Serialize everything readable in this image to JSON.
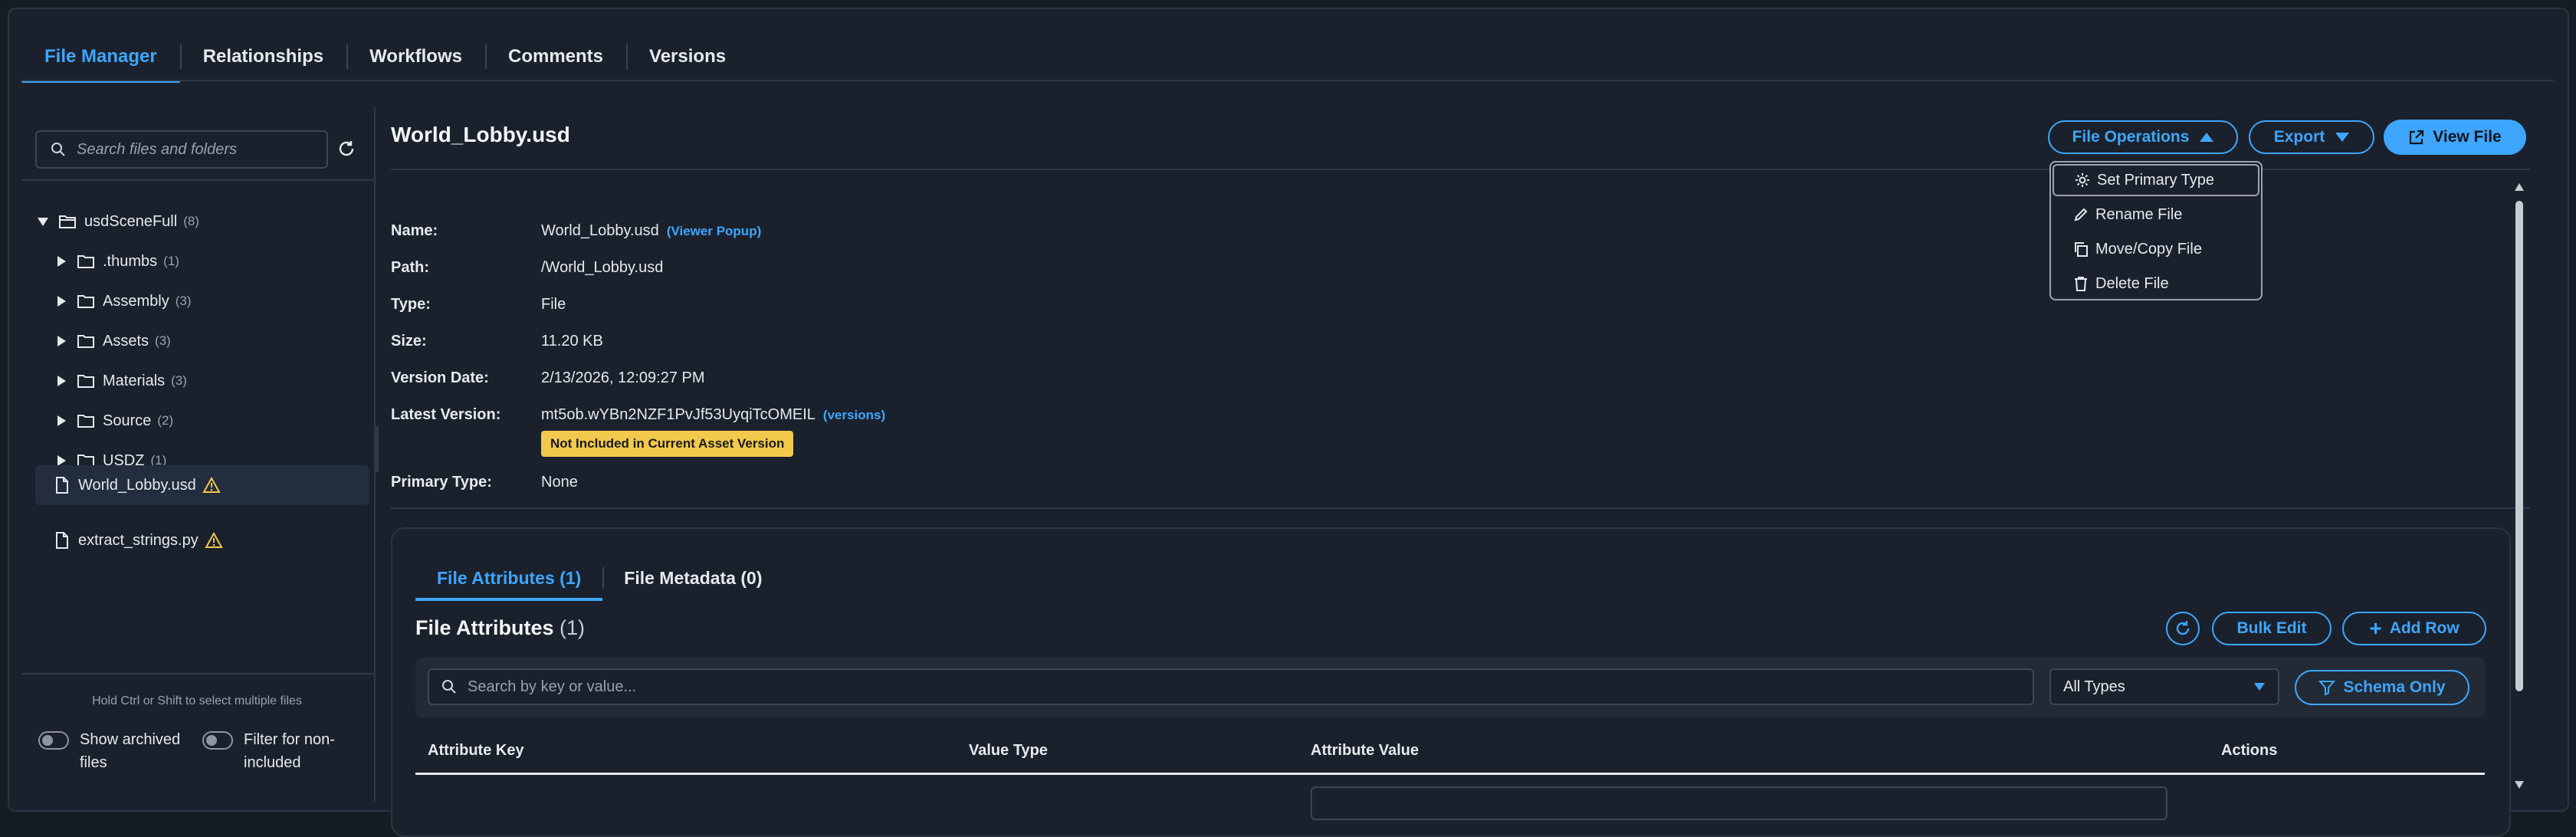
{
  "top_tabs": [
    "File Manager",
    "Relationships",
    "Workflows",
    "Comments",
    "Versions"
  ],
  "sidebar": {
    "search_placeholder": "Search files and folders",
    "root": {
      "name": "usdSceneFull",
      "count": "(8)"
    },
    "folders": [
      {
        "name": ".thumbs",
        "count": "(1)"
      },
      {
        "name": "Assembly",
        "count": "(3)"
      },
      {
        "name": "Assets",
        "count": "(3)"
      },
      {
        "name": "Materials",
        "count": "(3)"
      },
      {
        "name": "Source",
        "count": "(2)"
      },
      {
        "name": "USDZ",
        "count": "(1)"
      }
    ],
    "files": [
      {
        "name": "World_Lobby.usd",
        "warning": true,
        "selected": true
      },
      {
        "name": "extract_strings.py",
        "warning": true,
        "selected": false
      }
    ],
    "hint": "Hold Ctrl or Shift to select multiple files",
    "toggle_archived": [
      "Show archived",
      "files"
    ],
    "toggle_filter": [
      "Filter for non-",
      "included"
    ]
  },
  "main": {
    "title": "World_Lobby.usd",
    "buttons": {
      "file_operations": "File Operations",
      "export": "Export",
      "view_file": "View File"
    },
    "menu": [
      "Set Primary Type",
      "Rename File",
      "Move/Copy File",
      "Delete File"
    ],
    "props": {
      "name_label": "Name:",
      "name_value": "World_Lobby.usd",
      "viewer_link": "(Viewer Popup)",
      "path_label": "Path:",
      "path_value": "/World_Lobby.usd",
      "type_label": "Type:",
      "type_value": "File",
      "size_label": "Size:",
      "size_value": "11.20 KB",
      "version_date_label": "Version Date:",
      "version_date_value": "2/13/2026, 12:09:27 PM",
      "latest_version_label": "Latest Version:",
      "latest_version_value": "mt5ob.wYBn2NZF1PvJf53UyqiTcOMEIL",
      "versions_link": "(versions)",
      "badge": "Not Included in Current Asset Version",
      "primary_type_label": "Primary Type:",
      "primary_type_value": "None"
    }
  },
  "attributes": {
    "tabs": [
      "File Attributes (1)",
      "File Metadata (0)"
    ],
    "title": "File Attributes",
    "count": "(1)",
    "bulk_edit": "Bulk Edit",
    "add_row": "Add Row",
    "search_placeholder": "Search by key or value...",
    "type_select": "All Types",
    "schema_only": "Schema Only",
    "columns": [
      "Attribute Key",
      "Value Type",
      "Attribute Value",
      "Actions"
    ]
  },
  "colors": {
    "accent": "#3ea6ff",
    "warning": "#f2c94c",
    "background": "#1a212c"
  }
}
